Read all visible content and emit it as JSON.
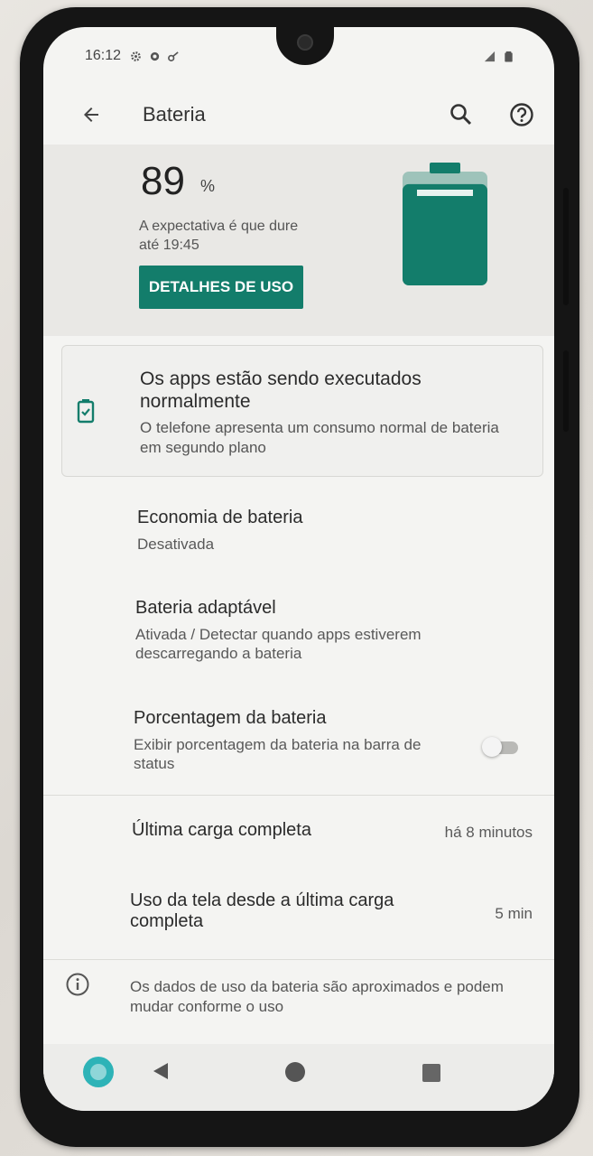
{
  "status_bar": {
    "time": "16:12"
  },
  "app_bar": {
    "title": "Bateria"
  },
  "header": {
    "percentage": "89",
    "percentage_unit": "%",
    "estimate_line1": "A expectativa é que dure",
    "estimate_line2": "até 19:45",
    "details_button": "DETALHES DE USO",
    "level_fraction": 0.89
  },
  "tip": {
    "title": "Os apps estão sendo executados normalmente",
    "subtitle": "O telefone apresenta um consumo normal de bateria em segundo plano"
  },
  "prefs": {
    "saver": {
      "title": "Economia de bateria",
      "summary": "Desativada"
    },
    "adaptive": {
      "title": "Bateria adaptável",
      "summary": "Ativada / Detectar quando apps estiverem descarregando a bateria"
    },
    "percent": {
      "title": "Porcentagem da bateria",
      "summary": "Exibir porcentagem da bateria na barra de status",
      "enabled": false
    }
  },
  "usage": {
    "last_charge": {
      "title": "Última carga completa",
      "value": "há 8 minutos"
    },
    "screen_usage": {
      "title": "Uso da tela desde a última carga completa",
      "value": "5 min"
    }
  },
  "footer": {
    "info": "Os dados de uso da bateria são aproximados e podem mudar conforme o uso"
  },
  "colors": {
    "accent": "#137d6b",
    "assistant": "#2eb3b7"
  }
}
